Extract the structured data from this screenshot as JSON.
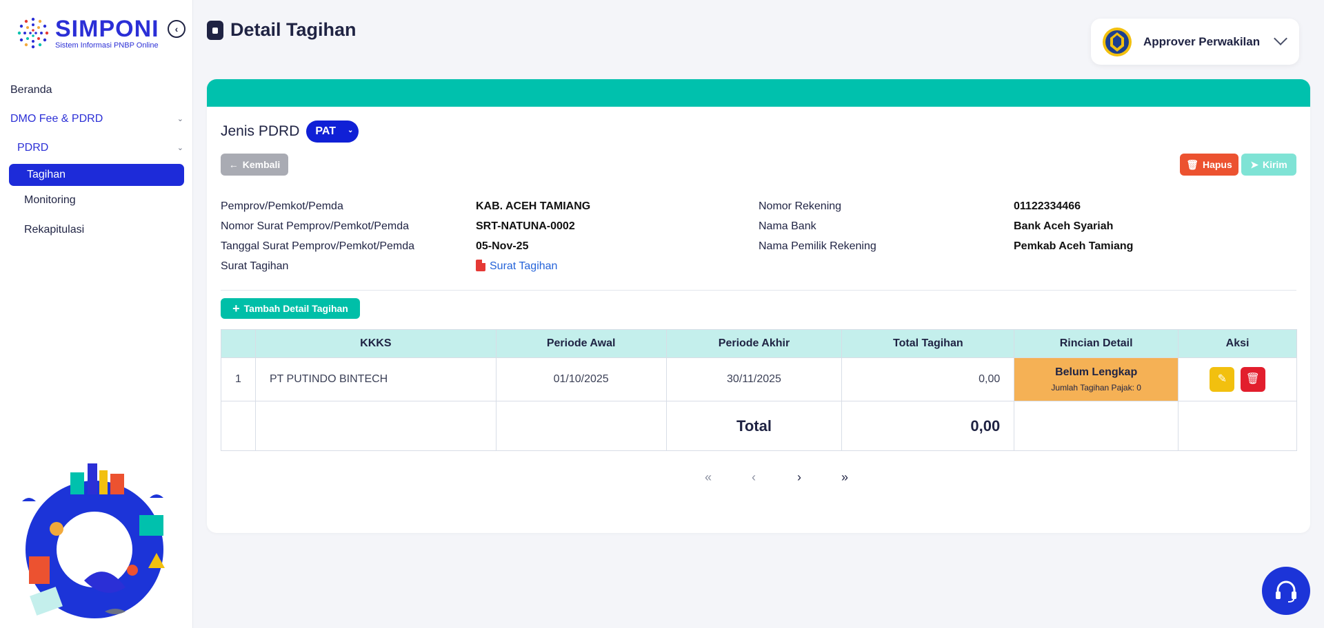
{
  "sidebar": {
    "logo_title": "SIMPONI",
    "logo_subtitle": "Sistem Informasi PNBP Online",
    "items": [
      {
        "label": "Beranda"
      },
      {
        "label": "DMO Fee & PDRD"
      },
      {
        "label": "PDRD"
      },
      {
        "label": "Tagihan"
      },
      {
        "label": "Monitoring"
      },
      {
        "label": "Rekapitulasi"
      }
    ]
  },
  "header": {
    "title": "Detail Tagihan",
    "user": "Approver Perwakilan"
  },
  "jenis": {
    "label": "Jenis PDRD",
    "value": "PAT"
  },
  "buttons": {
    "back": "Kembali",
    "delete": "Hapus",
    "send": "Kirim",
    "add": "Tambah Detail Tagihan"
  },
  "info": {
    "left": [
      {
        "label": "Pemprov/Pemkot/Pemda",
        "value": "KAB. ACEH TAMIANG"
      },
      {
        "label": "Nomor Surat Pemprov/Pemkot/Pemda",
        "value": "SRT-NATUNA-0002"
      },
      {
        "label": "Tanggal Surat Pemprov/Pemkot/Pemda",
        "value": "05-Nov-25"
      },
      {
        "label": "Surat Tagihan",
        "value": "Surat Tagihan"
      }
    ],
    "right": [
      {
        "label": "Nomor Rekening",
        "value": "01122334466"
      },
      {
        "label": "Nama Bank",
        "value": "Bank Aceh Syariah"
      },
      {
        "label": "Nama Pemilik Rekening",
        "value": "Pemkab Aceh Tamiang"
      }
    ]
  },
  "table": {
    "headers": [
      "",
      "KKKS",
      "Periode Awal",
      "Periode Akhir",
      "Total Tagihan",
      "Rincian Detail",
      "Aksi"
    ],
    "rows": [
      {
        "no": "1",
        "kkks": "PT PUTINDO BINTECH",
        "periode_awal": "01/10/2025",
        "periode_akhir": "30/11/2025",
        "total": "0,00",
        "status": "Belum Lengkap",
        "status_sub": "Jumlah Tagihan Pajak: 0"
      }
    ],
    "total_label": "Total",
    "total_value": "0,00"
  },
  "colors": {
    "accent_teal": "#00c1ad",
    "primary_blue": "#1d2bd9",
    "status_orange": "#f5b155",
    "danger": "#e21e2d",
    "warning": "#f2c00f"
  }
}
